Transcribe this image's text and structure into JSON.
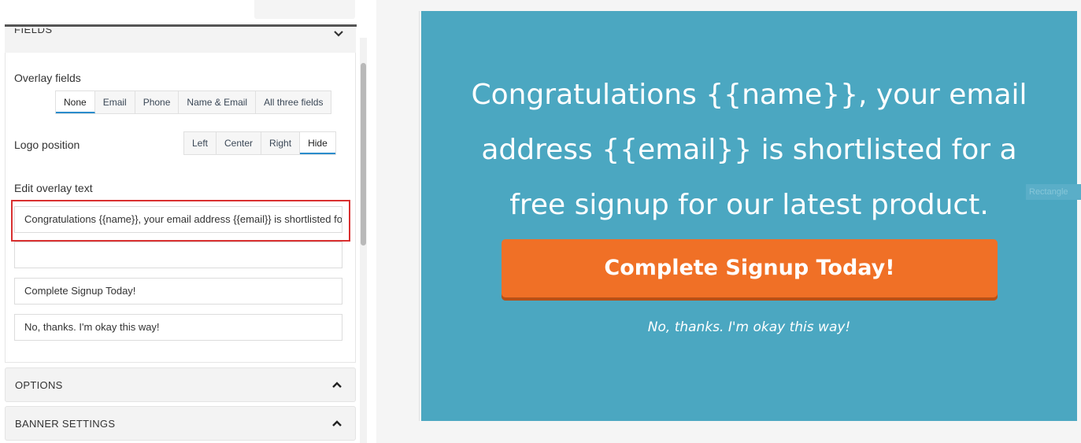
{
  "fields_section": {
    "title": "FIELDS",
    "overlay_fields": {
      "label": "Overlay fields",
      "options": [
        "None",
        "Email",
        "Phone",
        "Name & Email",
        "All three fields"
      ],
      "selected": "None"
    },
    "logo_position": {
      "label": "Logo position",
      "options": [
        "Left",
        "Center",
        "Right",
        "Hide"
      ],
      "selected": "Hide"
    },
    "edit_overlay_text": {
      "label": "Edit overlay text",
      "headline_value": "Congratulations {{name}}, your email address {{email}} is shortlisted for a free signup for our latest product.",
      "second_value": "",
      "button_value": "Complete Signup Today!",
      "decline_value": "No, thanks. I'm okay this way!"
    }
  },
  "sections": {
    "options": "OPTIONS",
    "banner_settings": "BANNER SETTINGS"
  },
  "preview": {
    "headline_lines": [
      "Congratulations {{name}}, your email",
      "address {{email}} is shortlisted for a",
      "free signup for our latest product."
    ],
    "cta": "Complete Signup Today!",
    "decline": "No, thanks. I'm okay this way!",
    "tag": "Rectangle",
    "background_color": "#4ba7c1",
    "cta_color": "#f07026"
  },
  "colors": {
    "highlight_outline": "#d93030",
    "active_tab_underline": "#2a8ccc"
  }
}
